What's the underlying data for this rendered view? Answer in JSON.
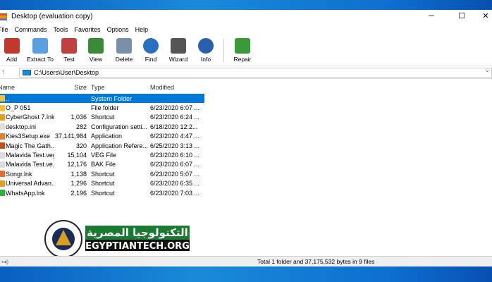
{
  "window": {
    "title": "Desktop (evaluation copy)",
    "minimize": "─",
    "maximize": "☐",
    "close": "✕"
  },
  "menu": [
    "File",
    "Commands",
    "Tools",
    "Favorites",
    "Options",
    "Help"
  ],
  "toolbar": [
    {
      "label": "Add",
      "icon": "add-archive-icon",
      "color": "#c0392b"
    },
    {
      "label": "Extract To",
      "icon": "folder-extract-icon",
      "color": "#5aa0e0"
    },
    {
      "label": "Test",
      "icon": "clipboard-check-icon",
      "color": "#c04040"
    },
    {
      "label": "View",
      "icon": "book-icon",
      "color": "#3a8a3a"
    },
    {
      "label": "Delete",
      "icon": "trash-icon",
      "color": "#7a8fa8"
    },
    {
      "label": "Find",
      "icon": "magnifier-icon",
      "color": "#2a6fc0"
    },
    {
      "label": "Wizard",
      "icon": "magic-wand-icon",
      "color": "#555"
    },
    {
      "label": "Info",
      "icon": "info-icon",
      "color": "#2a5fb0"
    },
    {
      "label": "Repair",
      "icon": "repair-icon",
      "color": "#3a9a3a"
    }
  ],
  "address": {
    "up": "↑",
    "path": "C:\\Users\\User\\Desktop",
    "dropdown": "⌄"
  },
  "columns": [
    "Name",
    "Size",
    "Type",
    "Modified"
  ],
  "files": [
    {
      "name": "..",
      "size": "",
      "type": "System Folder",
      "modified": "",
      "color": "#f0c040"
    },
    {
      "name": "O_P 051",
      "size": "",
      "type": "File folder",
      "modified": "6/23/2020 6:07 ...",
      "color": "#f0c040"
    },
    {
      "name": "CyberGhost 7.lnk",
      "size": "1,036",
      "type": "Shortcut",
      "modified": "6/23/2020 6:24 ...",
      "color": "#e0a020"
    },
    {
      "name": "desktop.ini",
      "size": "282",
      "type": "Configuration setti...",
      "modified": "6/18/2020 12:2...",
      "color": "#ddd"
    },
    {
      "name": "Kies3Setup.exe",
      "size": "37,141,984",
      "type": "Application",
      "modified": "6/23/2020 4:47 ...",
      "color": "#e08030"
    },
    {
      "name": "Magic The Gath...",
      "size": "320",
      "type": "Application Refere...",
      "modified": "6/25/2020 3:13 ...",
      "color": "#c05020"
    },
    {
      "name": "Malavida Test.veg",
      "size": "15,104",
      "type": "VEG File",
      "modified": "6/23/2020 6:10 ...",
      "color": "#ddd"
    },
    {
      "name": "Malavida Test.ve...",
      "size": "12,176",
      "type": "BAK File",
      "modified": "6/23/2020 6:07 ...",
      "color": "#ddd"
    },
    {
      "name": "Songr.lnk",
      "size": "1,138",
      "type": "Shortcut",
      "modified": "6/23/2020 5:07 ...",
      "color": "#e07030"
    },
    {
      "name": "Universal Advan...",
      "size": "1,296",
      "type": "Shortcut",
      "modified": "6/23/2020 6:35 ...",
      "color": "#e0a020"
    },
    {
      "name": "WhatsApp.lnk",
      "size": "2,196",
      "type": "Shortcut",
      "modified": "6/23/2020 7:03 ...",
      "color": "#30b040"
    }
  ],
  "status": {
    "summary": "Total 1 folder and 37,175,532 bytes in 9 files"
  },
  "watermark": {
    "arabic": "التكنولوجيا المصرية",
    "latin": "EGYPTIANTECH.ORG",
    "seal": "EGYPTIAN TECH"
  }
}
